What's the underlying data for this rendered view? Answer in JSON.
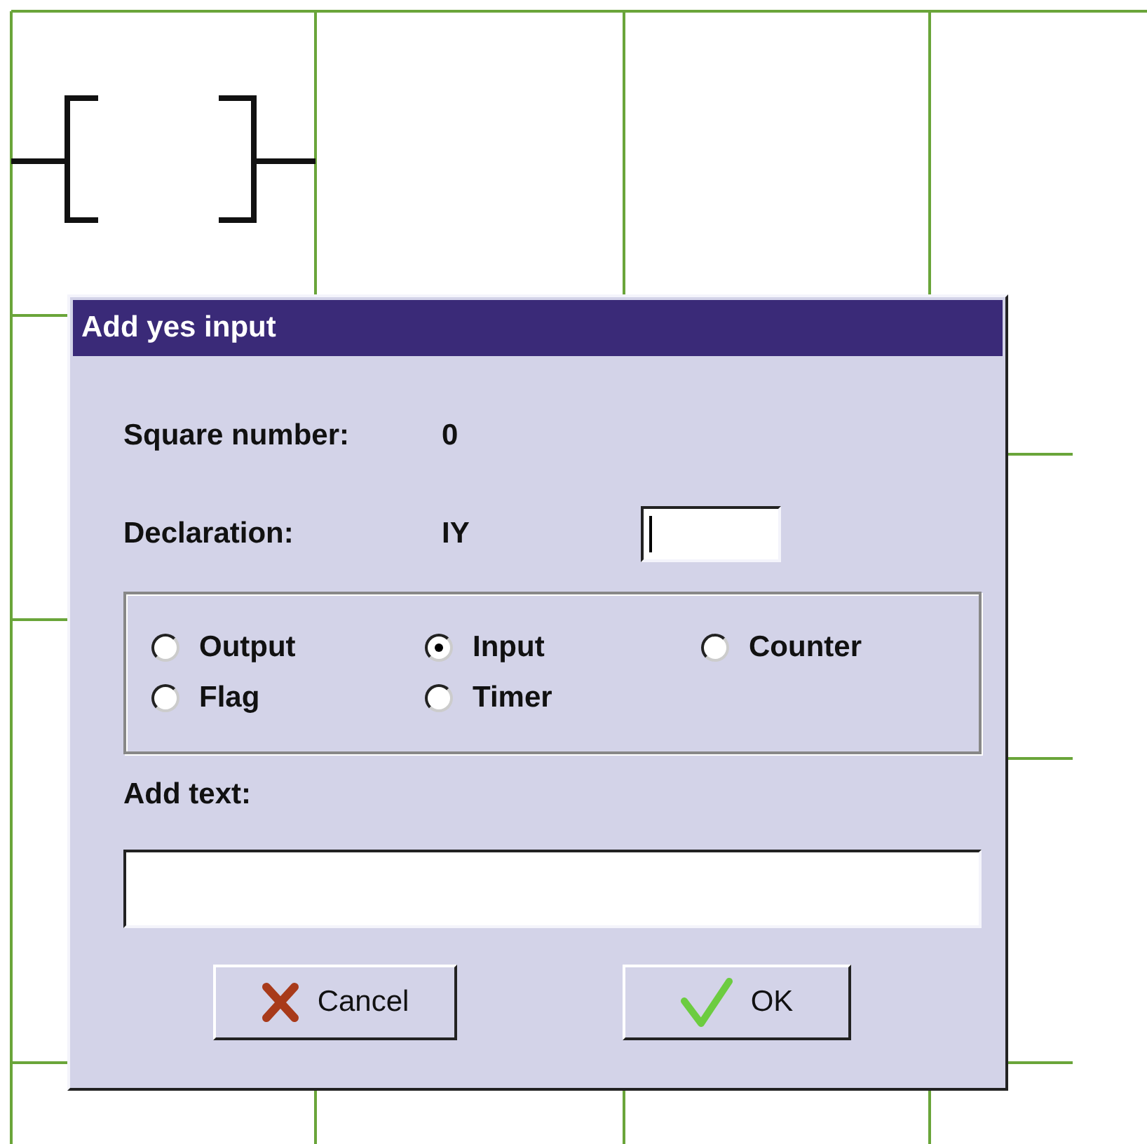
{
  "dialog": {
    "title": "Add yes input",
    "square_number": {
      "label": "Square number:",
      "value": "0"
    },
    "declaration": {
      "label": "Declaration:",
      "value": "IY"
    },
    "options": [
      {
        "label": "Output",
        "selected": false
      },
      {
        "label": "Input",
        "selected": true
      },
      {
        "label": "Counter",
        "selected": false
      },
      {
        "label": "Flag",
        "selected": false
      },
      {
        "label": "Timer",
        "selected": false
      }
    ],
    "add_text": {
      "label": "Add text:"
    },
    "buttons": [
      {
        "label": "Cancel",
        "kind": "cancel"
      },
      {
        "label": "OK",
        "kind": "ok"
      }
    ]
  }
}
